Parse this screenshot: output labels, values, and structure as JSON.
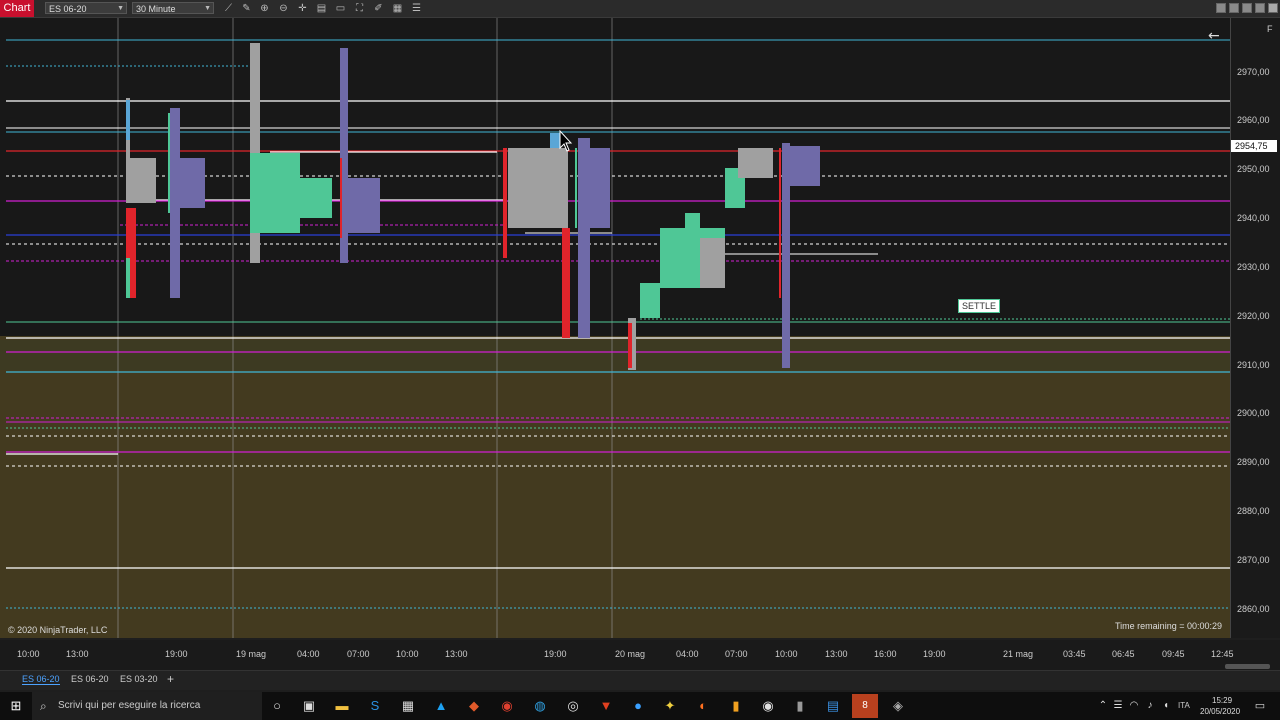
{
  "window": {
    "app_label": "Chart",
    "instrument": "ES 06-20",
    "interval": "30 Minute"
  },
  "toolbar_icons": [
    "trend-line-icon",
    "pencil-icon",
    "zoom-in-icon",
    "zoom-out-icon",
    "crosshair-icon",
    "properties-icon",
    "data-box-icon",
    "maximize-icon",
    "drawing-tools-icon",
    "chart-style-icon",
    "strategies-icon"
  ],
  "chart": {
    "copyright": "© 2020 NinjaTrader, LLC",
    "time_remaining": "Time remaining = 00:00:29",
    "settle_label": "SETTLE",
    "current_price": "2954,75",
    "corner_label": "F",
    "colors": {
      "background": "#181818",
      "lower_zone": "#433a1f",
      "value_area_green": "#4fc796",
      "profile_violet": "#6f6aa8",
      "bar_gray": "#a0a0a0",
      "red_line": "#e0242b",
      "magenta_line": "#d21fd2",
      "blue_line": "#2a3fd6",
      "cyan_line": "#3fb6d6",
      "current_price_bg": "#ffffff"
    }
  },
  "price_axis": {
    "ticks": [
      "2970,00",
      "2960,00",
      "2950,00",
      "2940,00",
      "2930,00",
      "2920,00",
      "2910,00",
      "2900,00",
      "2890,00",
      "2880,00",
      "2870,00",
      "2860,00"
    ]
  },
  "time_axis": {
    "ticks": [
      "10:00",
      "13:00",
      "19:00",
      "19 mag",
      "04:00",
      "07:00",
      "10:00",
      "13:00",
      "19:00",
      "20 mag",
      "04:00",
      "07:00",
      "10:00",
      "13:00",
      "16:00",
      "19:00",
      "21 mag",
      "03:45",
      "06:45",
      "09:45",
      "12:45"
    ]
  },
  "tabs": [
    {
      "label": "ES 06-20"
    },
    {
      "label": "ES 06-20"
    },
    {
      "label": "ES 03-20"
    }
  ],
  "taskbar": {
    "search_placeholder": "Scrivi qui per eseguire la ricerca",
    "time": "15:29",
    "date": "20/05/2020",
    "lang": "ITA",
    "badge": "8"
  }
}
